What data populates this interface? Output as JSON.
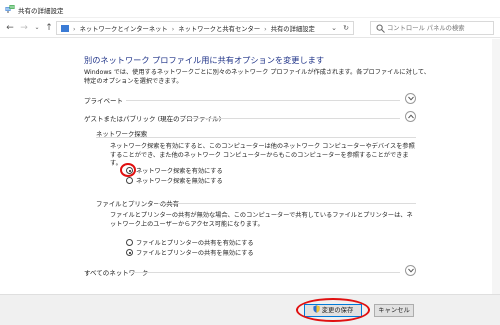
{
  "window": {
    "title": "共有の詳細設定"
  },
  "nav": {
    "breadcrumbs": [
      "ネットワークとインターネット",
      "ネットワークと共有センター",
      "共有の詳細設定"
    ],
    "search_placeholder": "コントロール パネルの検索"
  },
  "main": {
    "heading": "別のネットワーク プロファイル用に共有オプションを変更します",
    "intro": "Windows では、使用するネットワークごとに別々のネットワーク プロファイルが作成されます。各プロファイルに対して、特定のオプションを選択できます。",
    "profiles": {
      "private": {
        "label": "プライベート"
      },
      "guest_public": {
        "label": "ゲストまたはパブリック (現在のプロファイル)"
      },
      "all_networks": {
        "label": "すべてのネットワーク"
      }
    },
    "network_discovery": {
      "title": "ネットワーク探索",
      "description": "ネットワーク探索を有効にすると、このコンピューターは他のネットワーク コンピューターやデバイスを参照することができ、また他のネットワーク コンピューターからもこのコンピューターを参照することができます。",
      "options": [
        {
          "label": "ネットワーク探索を有効にする",
          "selected": true
        },
        {
          "label": "ネットワーク探索を無効にする",
          "selected": false
        }
      ]
    },
    "file_printer_sharing": {
      "title": "ファイルとプリンターの共有",
      "description": "ファイルとプリンターの共有が無効な場合、このコンピューターで共有しているファイルとプリンターは、ネットワーク上のユーザーからアクセス可能になります。",
      "options": [
        {
          "label": "ファイルとプリンターの共有を有効にする",
          "selected": false
        },
        {
          "label": "ファイルとプリンターの共有を無効にする",
          "selected": true
        }
      ]
    }
  },
  "footer": {
    "save_label": "変更の保存",
    "cancel_label": "キャンセル"
  },
  "colors": {
    "heading": "#1e3287",
    "highlight": "#e01010",
    "accent": "#0078d7"
  }
}
